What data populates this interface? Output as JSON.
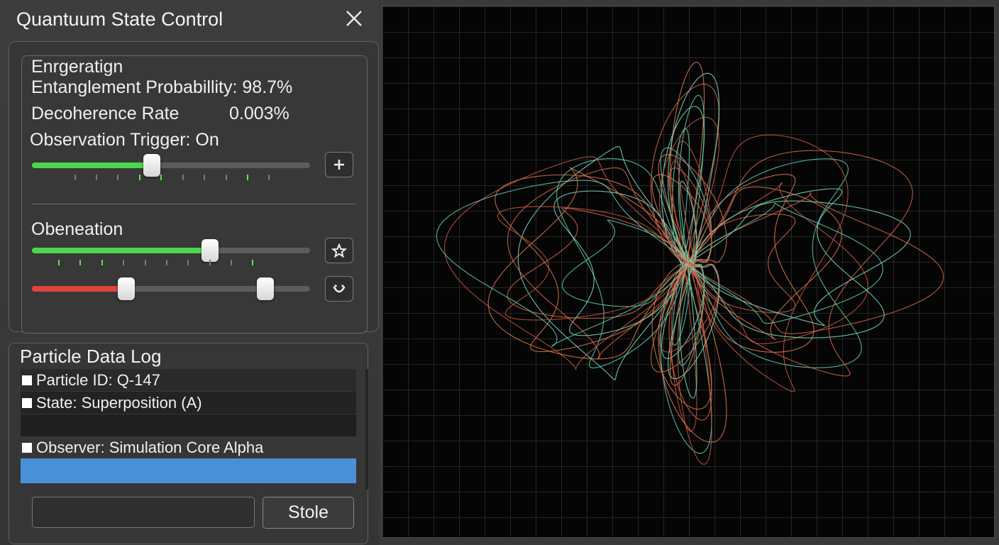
{
  "panel": {
    "title": "Quantuum State Control",
    "close_icon": "close-icon"
  },
  "controls": {
    "section_heading": "Enrgeratign",
    "entanglement": "Entanglement Probabillity: 98.7%",
    "decoherence_label": "Decoherence Rate",
    "decoherence_value": "0.003%",
    "observation_trigger": "Observation Trigger: On",
    "slider1": {
      "level": 0.43,
      "color": "#4cd64c",
      "button_icon": "plus-icon"
    },
    "sub_heading": "Obeneation",
    "slider2": {
      "level": 0.64,
      "color": "#4cd64c",
      "button_icon": "star-icon"
    },
    "slider3": {
      "low": 0.34,
      "high": 0.84,
      "color": "#e0443a",
      "button_icon": "smile-icon"
    }
  },
  "log": {
    "title": "Particle Data Log",
    "rows": [
      "Particle ID: Q-147",
      "State: Superposition (A)",
      "",
      "Observer: Simulation Core Alpha"
    ],
    "highlight_color": "#4a90d9"
  },
  "command": {
    "input_value": "",
    "button_label": "Stole"
  },
  "visualization": {
    "colors": [
      "#d9694a",
      "#5fd1b3",
      "#e07a52",
      "#7fe0c0",
      "#c9583f"
    ]
  }
}
